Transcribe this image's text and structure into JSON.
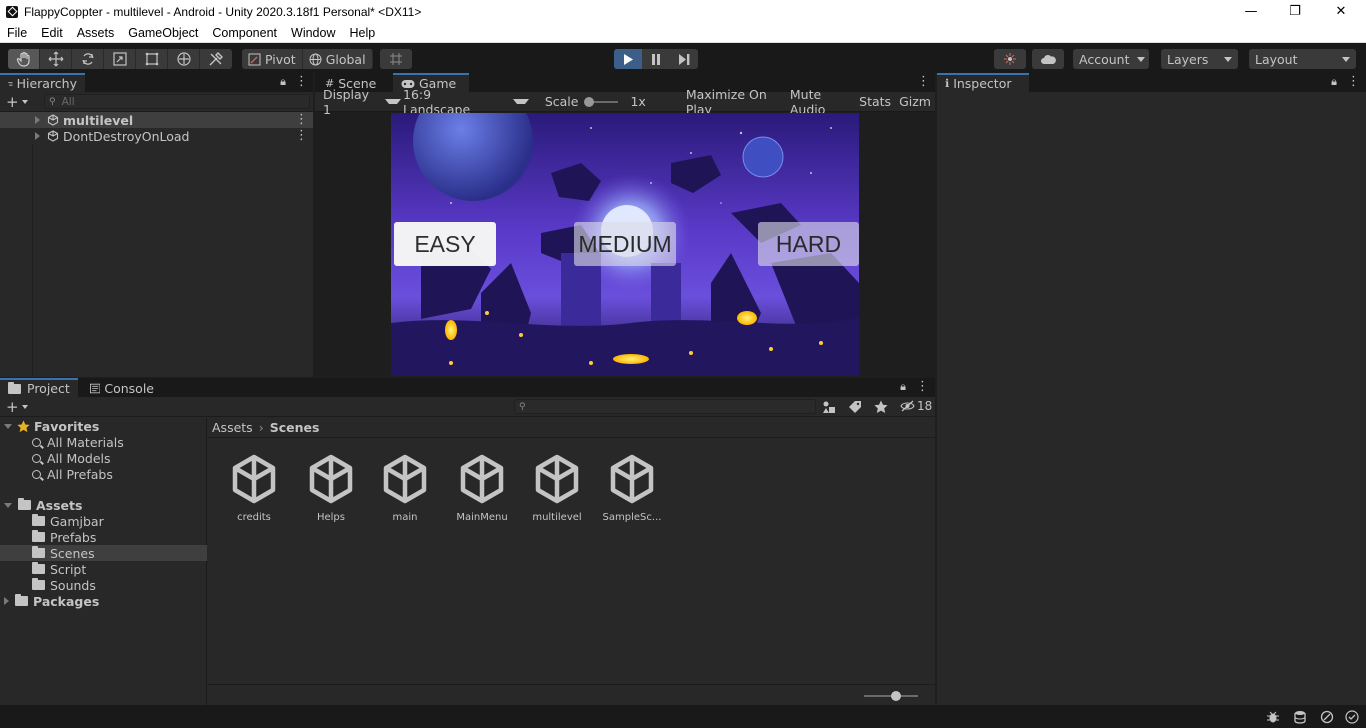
{
  "window": {
    "title": "FlappyCoppter - multilevel - Android - Unity 2020.3.18f1 Personal* <DX11>",
    "minimize": "—",
    "maximize": "❐",
    "close": "✕"
  },
  "menu": [
    "File",
    "Edit",
    "Assets",
    "GameObject",
    "Component",
    "Window",
    "Help"
  ],
  "toolbar": {
    "pivot_label": "Pivot",
    "global_label": "Global",
    "account_label": "Account",
    "layers_label": "Layers",
    "layout_label": "Layout",
    "play_state": "playing"
  },
  "hierarchy": {
    "tab_label": "Hierarchy",
    "search_placeholder": "All",
    "items": [
      {
        "label": "multilevel",
        "selected": true
      },
      {
        "label": "DontDestroyOnLoad",
        "selected": false
      }
    ]
  },
  "game_tabs": {
    "scene_label": "Scene",
    "game_label": "Game"
  },
  "game_options": {
    "display": "Display 1",
    "aspect": "16:9 Landscape",
    "scale_label": "Scale",
    "scale_value": "1x",
    "maximize": "Maximize On Play",
    "mute": "Mute Audio",
    "stats": "Stats",
    "gizmos": "Gizm"
  },
  "game_buttons": [
    "EASY",
    "MEDIUM",
    "HARD"
  ],
  "inspector": {
    "tab_label": "Inspector"
  },
  "project": {
    "project_tab": "Project",
    "console_tab": "Console",
    "hidden_count": "18",
    "breadcrumb": [
      "Assets",
      "Scenes"
    ],
    "favorites": {
      "label": "Favorites",
      "items": [
        "All Materials",
        "All Models",
        "All Prefabs"
      ]
    },
    "assets": {
      "label": "Assets",
      "folders": [
        "Gamjbar",
        "Prefabs",
        "Scenes",
        "Script",
        "Sounds"
      ],
      "selected": "Scenes"
    },
    "packages_label": "Packages",
    "files": [
      "credits",
      "Helps",
      "main",
      "MainMenu",
      "multilevel",
      "SampleSc..."
    ]
  },
  "colors": {
    "accent_blue": "#3a72b0",
    "play_active": "#3c5f8a",
    "panel_bg": "#282828",
    "toolbar_bg": "#191919"
  }
}
